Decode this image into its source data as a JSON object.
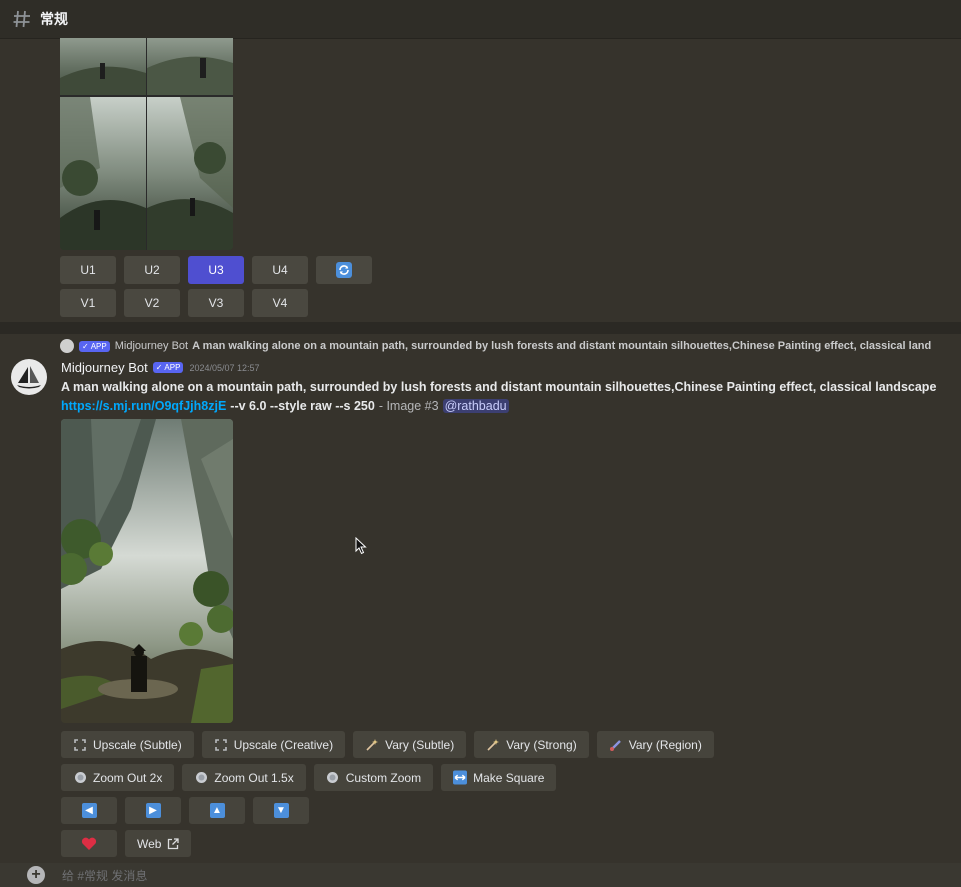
{
  "channel": {
    "name": "常规",
    "icon": "hash-icon"
  },
  "previous_message": {
    "upscale_buttons": [
      "U1",
      "U2",
      "U3",
      "U4"
    ],
    "active_upscale": "U3",
    "reroll_icon": "refresh-icon",
    "variation_buttons": [
      "V1",
      "V2",
      "V3",
      "V4"
    ]
  },
  "reply": {
    "app_badge": "APP",
    "author": "Midjourney Bot",
    "prompt": "A man walking alone on a mountain path, surrounded by lush forests and distant mountain silhouettes,Chinese Painting effect, classical land"
  },
  "message": {
    "author": "Midjourney Bot",
    "app_badge": "APP",
    "timestamp": "2024/05/07 12:57",
    "prompt": "A man walking alone on a mountain path, surrounded by lush forests and distant mountain silhouettes,Chinese Painting effect, classical landscape",
    "link": "https://s.mj.run/O9qfJjh8zjE",
    "params": "--v 6.0 --style raw --s 250",
    "image_label": "- Image #3",
    "mention": "@rathbadu"
  },
  "actions": {
    "row1": [
      {
        "label": "Upscale (Subtle)",
        "icon": "upscale-icon"
      },
      {
        "label": "Upscale (Creative)",
        "icon": "upscale-icon"
      },
      {
        "label": "Vary (Subtle)",
        "icon": "sparkle-icon"
      },
      {
        "label": "Vary (Strong)",
        "icon": "sparkle-icon"
      },
      {
        "label": "Vary (Region)",
        "icon": "brush-icon"
      }
    ],
    "row2": [
      {
        "label": "Zoom Out 2x",
        "icon": "zoom-icon"
      },
      {
        "label": "Zoom Out 1.5x",
        "icon": "zoom-icon"
      },
      {
        "label": "Custom Zoom",
        "icon": "zoom-icon"
      },
      {
        "label": "Make Square",
        "icon": "arrows-horizontal-icon"
      }
    ],
    "pan": [
      "arrow-left-icon",
      "arrow-right-icon",
      "arrow-up-icon",
      "arrow-down-icon"
    ],
    "web_label": "Web"
  },
  "composer": {
    "placeholder": "给 #常规 发消息"
  },
  "colors": {
    "accent": "#4f4fd0",
    "link": "#00a8fc",
    "app_badge": "#5865f2"
  }
}
